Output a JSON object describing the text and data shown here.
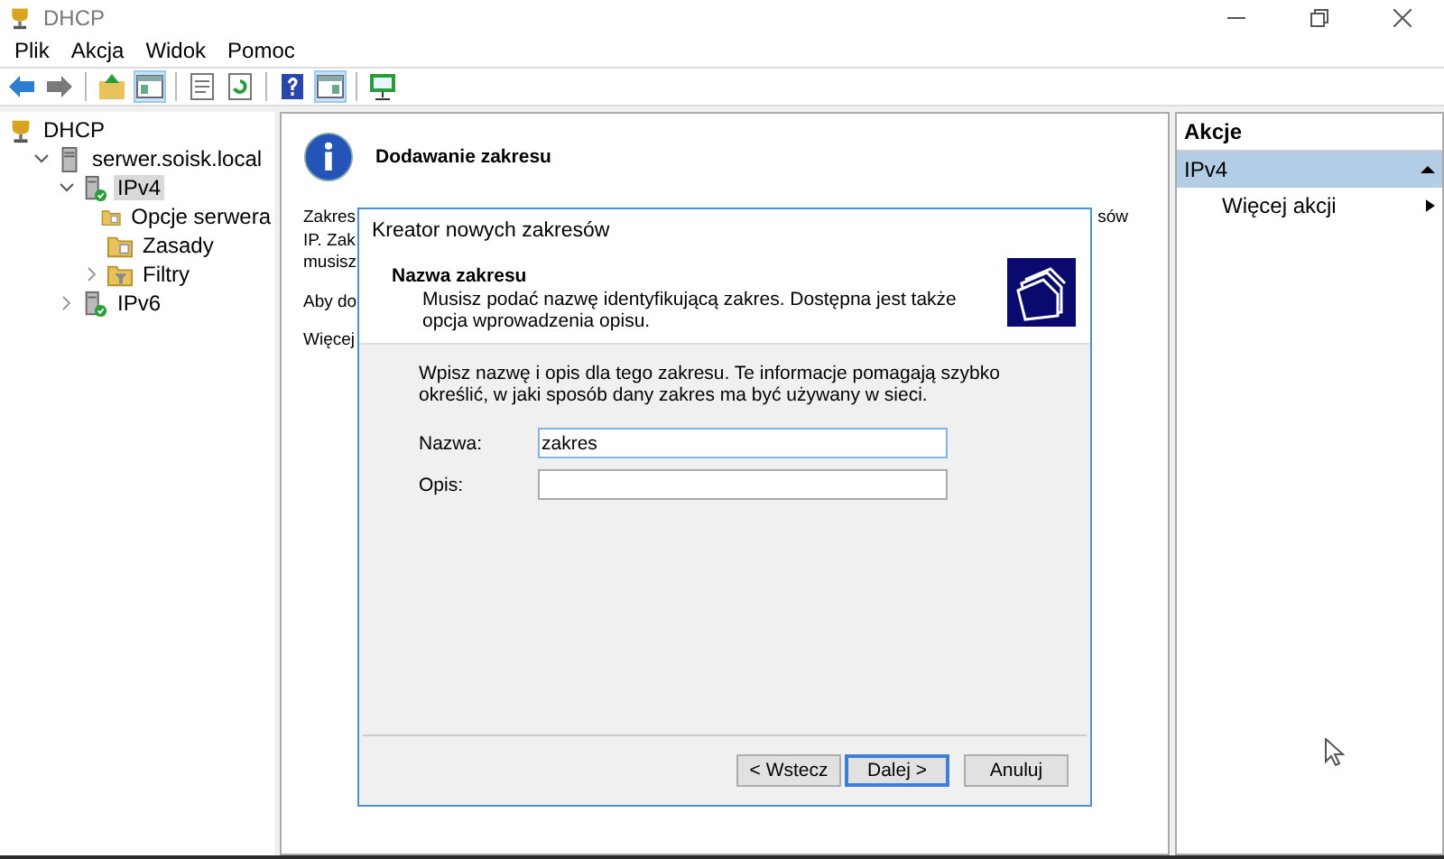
{
  "window": {
    "title": "DHCP"
  },
  "menu": [
    "Plik",
    "Akcja",
    "Widok",
    "Pomoc"
  ],
  "toolbar": [
    {
      "kind": "back",
      "pressed": false
    },
    {
      "kind": "forward",
      "pressed": false
    },
    {
      "kind": "sep"
    },
    {
      "kind": "up",
      "pressed": false
    },
    {
      "kind": "pane",
      "pressed": true
    },
    {
      "kind": "sep"
    },
    {
      "kind": "properties",
      "pressed": false
    },
    {
      "kind": "refresh",
      "pressed": false
    },
    {
      "kind": "sep"
    },
    {
      "kind": "help",
      "pressed": false
    },
    {
      "kind": "pane2",
      "pressed": true
    },
    {
      "kind": "sep"
    },
    {
      "kind": "monitor",
      "pressed": false
    }
  ],
  "tree": [
    {
      "label": "DHCP",
      "kind": "dhcp",
      "selected": false,
      "children": [
        {
          "label": "serwer.soisk.local",
          "kind": "server",
          "expanded": true,
          "selected": false,
          "children": [
            {
              "label": "IPv4",
              "kind": "ip",
              "expanded": true,
              "selected": true,
              "children": [
                {
                  "label": "Opcje serwera",
                  "kind": "folder",
                  "selected": false
                },
                {
                  "label": "Zasady",
                  "kind": "folder",
                  "selected": false
                },
                {
                  "label": "Filtry",
                  "kind": "filter",
                  "expanded": false,
                  "selected": false
                }
              ]
            },
            {
              "label": "IPv6",
              "kind": "ip",
              "expanded": false,
              "selected": false
            }
          ]
        }
      ]
    }
  ],
  "content": {
    "heading": "Dodawanie zakresu",
    "paragraphs": [
      [
        {
          "left": "Zakres",
          "right": "sów"
        },
        {
          "left": "IP. Zak"
        },
        {
          "left": "musisz"
        }
      ],
      [
        {
          "left": "Aby do"
        }
      ],
      [
        {
          "left": "Więcej"
        }
      ]
    ]
  },
  "actions": {
    "title": "Akcje",
    "section": {
      "label": "IPv4",
      "expanded": true
    },
    "items": [
      "Więcej akcji"
    ]
  },
  "dialog": {
    "title": "Kreator nowych zakresów",
    "heading": "Nazwa zakresu",
    "description": "Musisz podać nazwę identyfikującą zakres. Dostępna jest także opcja wprowadzenia opisu.",
    "intro": "Wpisz nazwę i opis dla tego zakresu. Te informacje pomagają szybko określić, w jaki sposób dany zakres ma być używany w sieci.",
    "fields": [
      {
        "label": "Nazwa:",
        "value": "zakres",
        "focused": true
      },
      {
        "label": "Opis:",
        "focused": false
      }
    ],
    "buttons": [
      {
        "label": "< Wstecz",
        "default": false
      },
      {
        "label": "Dalej >",
        "default": true
      },
      {
        "label": "Anuluj",
        "default": false
      }
    ]
  }
}
